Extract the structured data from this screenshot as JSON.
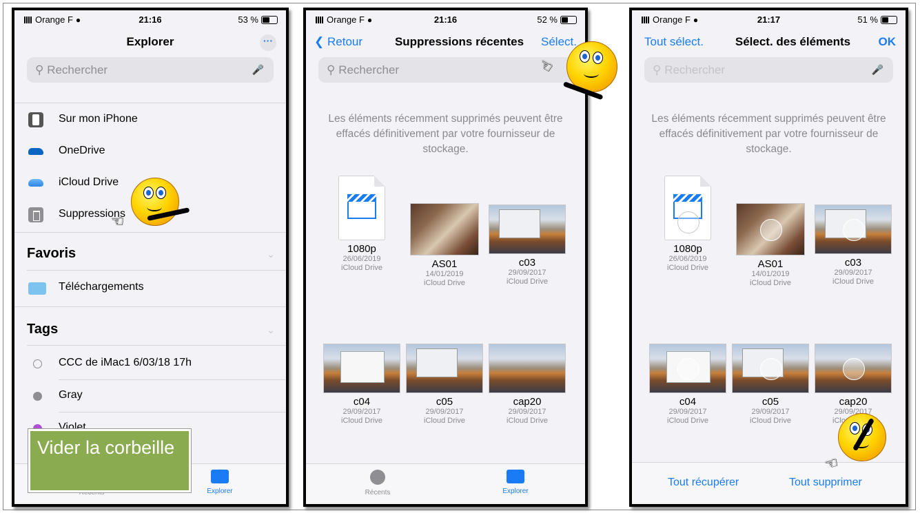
{
  "panel1": {
    "status": {
      "carrier": "Orange F",
      "time": "21:16",
      "battery": "53 %",
      "battery_level": 0.53
    },
    "title": "Explorer",
    "more_icon": "ellipsis-circle-icon",
    "search_placeholder": "Rechercher",
    "locations": [
      {
        "label": "Sur mon iPhone",
        "icon": "iphone-icon"
      },
      {
        "label": "OneDrive",
        "icon": "cloud-icon"
      },
      {
        "label": "iCloud Drive",
        "icon": "icloud-icon"
      },
      {
        "label": "Suppressions",
        "icon": "trash-icon"
      }
    ],
    "favorites_header": "Favoris",
    "favorites": [
      {
        "label": "Téléchargements",
        "icon": "folder-download-icon"
      }
    ],
    "tags_header": "Tags",
    "tags": [
      {
        "label": "CCC de iMac1 6/03/18 17h",
        "color": "#ffffff"
      },
      {
        "label": "Gray",
        "color": "#8e8e93"
      },
      {
        "label": "Violet",
        "color": "#b04fd6"
      }
    ],
    "tabs": [
      {
        "label": "Récents"
      },
      {
        "label": "Explorer"
      }
    ],
    "overlay_text": "Vider la corbeille"
  },
  "panel2": {
    "status": {
      "carrier": "Orange F",
      "time": "21:16",
      "battery": "52 %",
      "battery_level": 0.52
    },
    "back": "Retour",
    "title": "Suppressions récentes",
    "select": "Sélect.",
    "search_placeholder": "Rechercher",
    "message": "Les éléments récemment supprimés peuvent être effacés définitivement par votre fournisseur de stockage.",
    "files": [
      {
        "name": "1080p",
        "date": "26/06/2019",
        "source": "iCloud Drive"
      },
      {
        "name": "AS01",
        "date": "14/01/2019",
        "source": "iCloud Drive"
      },
      {
        "name": "c03",
        "date": "29/09/2017",
        "source": "iCloud Drive"
      },
      {
        "name": "c04",
        "date": "29/09/2017",
        "source": "iCloud Drive"
      },
      {
        "name": "c05",
        "date": "29/09/2017",
        "source": "iCloud Drive"
      },
      {
        "name": "cap20",
        "date": "29/09/2017",
        "source": "iCloud Drive"
      }
    ],
    "tabs": [
      {
        "label": "Récents"
      },
      {
        "label": "Explorer"
      }
    ]
  },
  "panel3": {
    "status": {
      "carrier": "Orange F",
      "time": "21:17",
      "battery": "51 %",
      "battery_level": 0.51
    },
    "select_all": "Tout sélect.",
    "title": "Sélect. des éléments",
    "ok": "OK",
    "search_placeholder": "Rechercher",
    "message": "Les éléments récemment supprimés peuvent être effacés définitivement par votre fournisseur de stockage.",
    "files": [
      {
        "name": "1080p",
        "date": "26/06/2019",
        "source": "iCloud Drive"
      },
      {
        "name": "AS01",
        "date": "14/01/2019",
        "source": "iCloud Drive"
      },
      {
        "name": "c03",
        "date": "29/09/2017",
        "source": "iCloud Drive"
      },
      {
        "name": "c04",
        "date": "29/09/2017",
        "source": "iCloud Drive"
      },
      {
        "name": "c05",
        "date": "29/09/2017",
        "source": "iCloud Drive"
      },
      {
        "name": "cap20",
        "date": "29/09/2017",
        "source": "iCloud Drive"
      }
    ],
    "recover_all": "Tout récupérer",
    "delete_all": "Tout supprimer"
  },
  "colors": {
    "accent": "#1a7cf5",
    "overlay": "#8bab50"
  }
}
